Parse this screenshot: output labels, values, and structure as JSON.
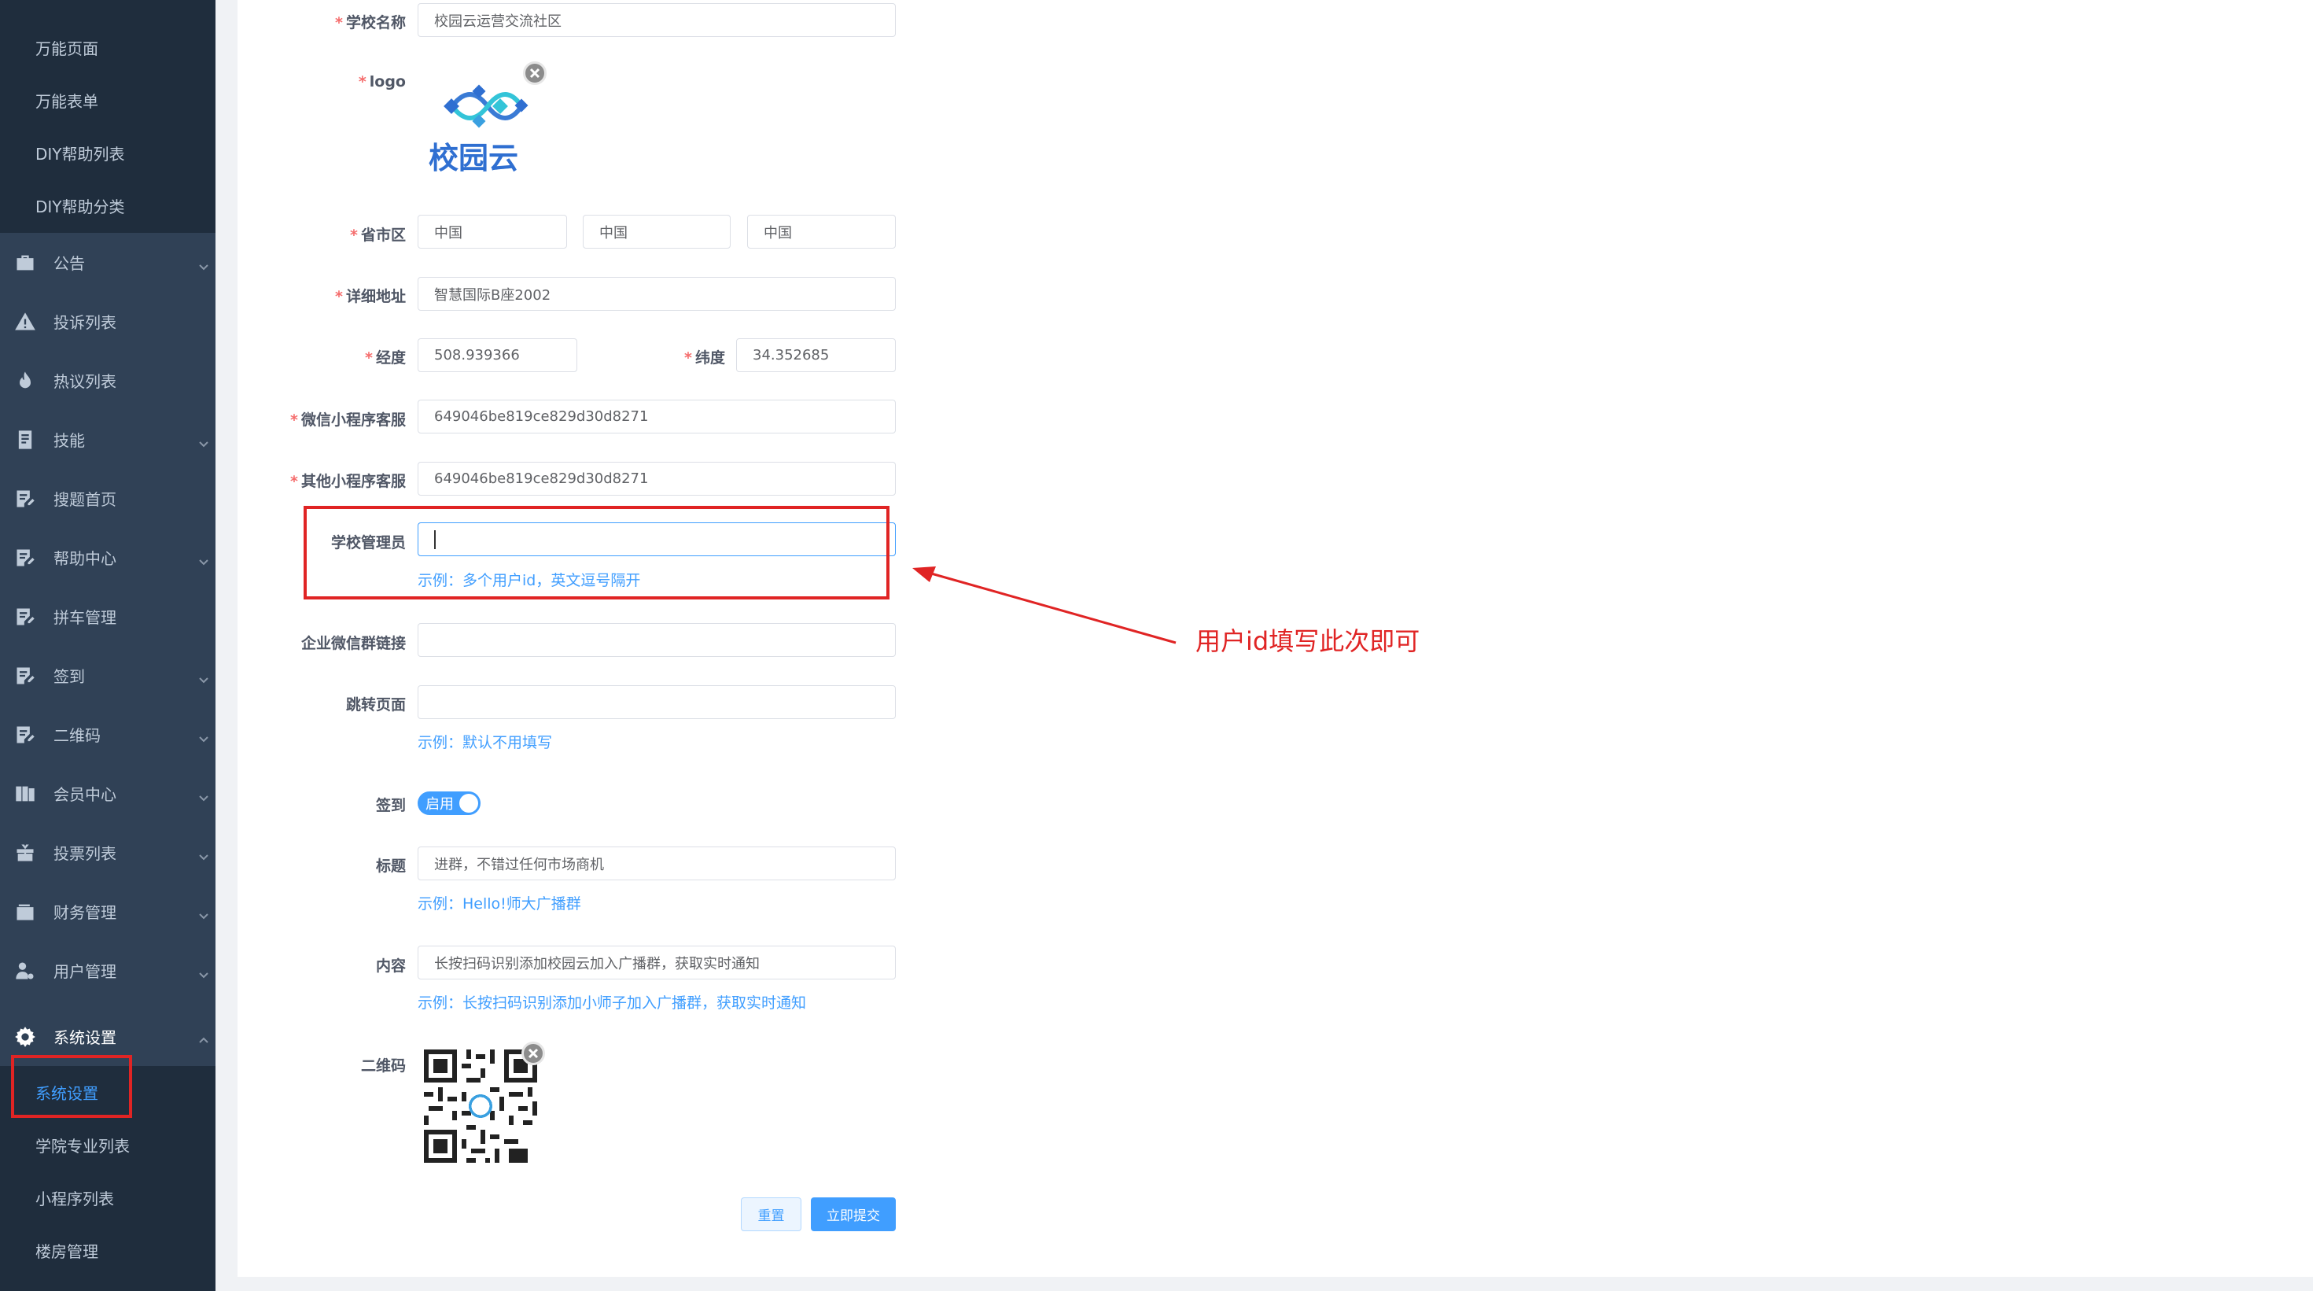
{
  "sidebar": {
    "top_sub_items": [
      {
        "label": "万能页面"
      },
      {
        "label": "万能表单"
      },
      {
        "label": "DIY帮助列表"
      },
      {
        "label": "DIY帮助分类"
      }
    ],
    "menu": [
      {
        "label": "公告",
        "icon": "briefcase-icon",
        "expandable": true
      },
      {
        "label": "投诉列表",
        "icon": "warning-icon",
        "expandable": false
      },
      {
        "label": "热议列表",
        "icon": "fire-icon",
        "expandable": false
      },
      {
        "label": "技能",
        "icon": "book-icon",
        "expandable": true
      },
      {
        "label": "搜题首页",
        "icon": "edit-doc-icon",
        "expandable": false
      },
      {
        "label": "帮助中心",
        "icon": "edit-doc-icon",
        "expandable": true
      },
      {
        "label": "拼车管理",
        "icon": "edit-doc-icon",
        "expandable": false
      },
      {
        "label": "签到",
        "icon": "edit-doc-icon",
        "expandable": true
      },
      {
        "label": "二维码",
        "icon": "edit-doc-icon",
        "expandable": true
      },
      {
        "label": "会员中心",
        "icon": "columns-icon",
        "expandable": true
      },
      {
        "label": "投票列表",
        "icon": "gift-icon",
        "expandable": true
      },
      {
        "label": "财务管理",
        "icon": "wallet-icon",
        "expandable": true
      },
      {
        "label": "用户管理",
        "icon": "user-gear-icon",
        "expandable": true
      },
      {
        "label": "系统设置",
        "icon": "gear-icon",
        "expandable": true,
        "open": true
      }
    ],
    "bottom_sub_items": [
      {
        "label": "系统设置",
        "active": true
      },
      {
        "label": "学院专业列表"
      },
      {
        "label": "小程序列表"
      },
      {
        "label": "楼房管理"
      }
    ]
  },
  "form": {
    "school_name": {
      "label": "学校名称",
      "value": "校园云运营交流社区"
    },
    "logo": {
      "label": "logo",
      "logo_text": "校园云"
    },
    "region": {
      "label": "省市区",
      "province": "中国",
      "city": "中国",
      "district": "中国"
    },
    "address": {
      "label": "详细地址",
      "value": "智慧国际B座2002"
    },
    "longitude": {
      "label": "经度",
      "value": "508.939366"
    },
    "latitude": {
      "label": "纬度",
      "value": "34.352685"
    },
    "wechat_service": {
      "label": "微信小程序客服",
      "value": "649046be819ce829d30d8271"
    },
    "other_service": {
      "label": "其他小程序客服",
      "value": "649046be819ce829d30d8271"
    },
    "school_admin": {
      "label": "学校管理员",
      "value": "",
      "hint": "示例：多个用户id，英文逗号隔开"
    },
    "wecom_link": {
      "label": "企业微信群链接",
      "value": ""
    },
    "jump_page": {
      "label": "跳转页面",
      "value": "",
      "hint": "示例：默认不用填写"
    },
    "signin": {
      "label": "签到",
      "switch_text": "启用",
      "enabled": true
    },
    "title": {
      "label": "标题",
      "value": "进群，不错过任何市场商机",
      "hint": "示例：Hello!师大广播群"
    },
    "content": {
      "label": "内容",
      "value": "长按扫码识别添加校园云加入广播群，获取实时通知",
      "hint": "示例：长按扫码识别添加小师子加入广播群，获取实时通知"
    },
    "qrcode": {
      "label": "二维码"
    },
    "reset_button": "重置",
    "submit_button": "立即提交"
  },
  "annotation": {
    "text": "用户id填写此次即可",
    "color": "#e02424"
  },
  "colors": {
    "sidebar_bg": "#304156",
    "submenu_bg": "#1f2d3d",
    "accent": "#409eff",
    "required": "#f56c6c"
  }
}
